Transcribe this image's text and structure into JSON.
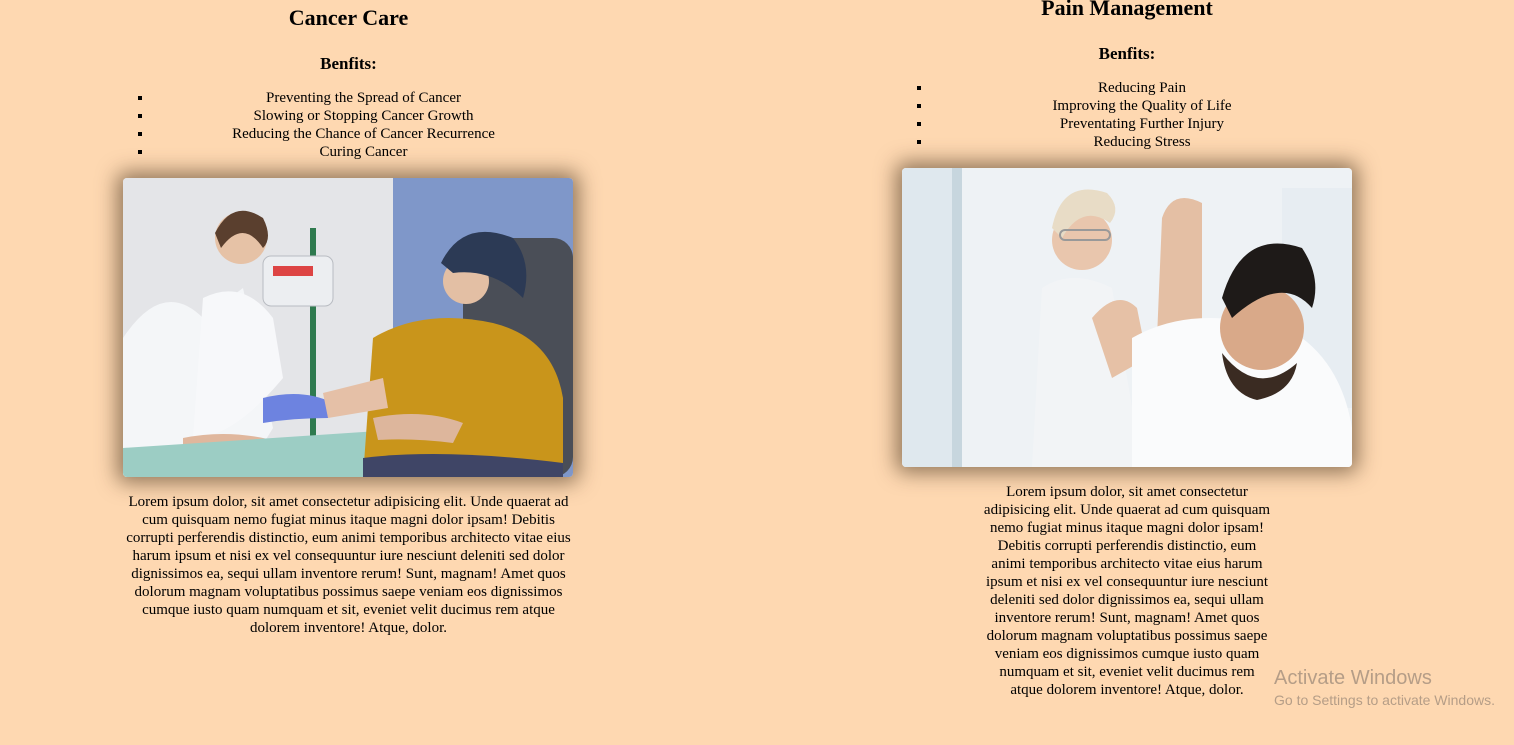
{
  "cards": [
    {
      "title": "Cancer Care",
      "subtitle": "Benfits:",
      "benefits": [
        "Preventing the Spread of Cancer",
        "Slowing or Stopping Cancer Growth",
        "Reducing the Chance of Cancer Recurrence",
        "Curing Cancer"
      ],
      "paragraph": "Lorem ipsum dolor, sit amet consectetur adipisicing elit. Unde quaerat ad cum quisquam nemo fugiat minus itaque magni dolor ipsam! Debitis corrupti perferendis distinctio, eum animi temporibus architecto vitae eius harum ipsum et nisi ex vel consequuntur iure nesciunt deleniti sed dolor dignissimos ea, sequi ullam inventore rerum! Sunt, magnam! Amet quos dolorum magnam voluptatibus possimus saepe veniam eos dignissimos cumque iusto quam numquam et sit, eveniet velit ducimus rem atque dolorem inventore! Atque, dolor."
    },
    {
      "title": "Pain Management",
      "subtitle": "Benfits:",
      "benefits": [
        "Reducing Pain",
        "Improving the Quality of Life",
        "Preventating Further Injury",
        "Reducing Stress"
      ],
      "paragraph": "Lorem ipsum dolor, sit amet consectetur adipisicing elit. Unde quaerat ad cum quisquam nemo fugiat minus itaque magni dolor ipsam! Debitis corrupti perferendis distinctio, eum animi temporibus architecto vitae eius harum ipsum et nisi ex vel consequuntur iure nesciunt deleniti sed dolor dignissimos ea, sequi ullam inventore rerum! Sunt, magnam! Amet quos dolorum magnam voluptatibus possimus saepe veniam eos dignissimos cumque iusto quam numquam et sit, eveniet velit ducimus rem atque dolorem inventore! Atque, dolor."
    }
  ],
  "watermark": {
    "title": "Activate Windows",
    "subtitle": "Go to Settings to activate Windows."
  },
  "colors": {
    "page_background": "#fed8b1"
  }
}
